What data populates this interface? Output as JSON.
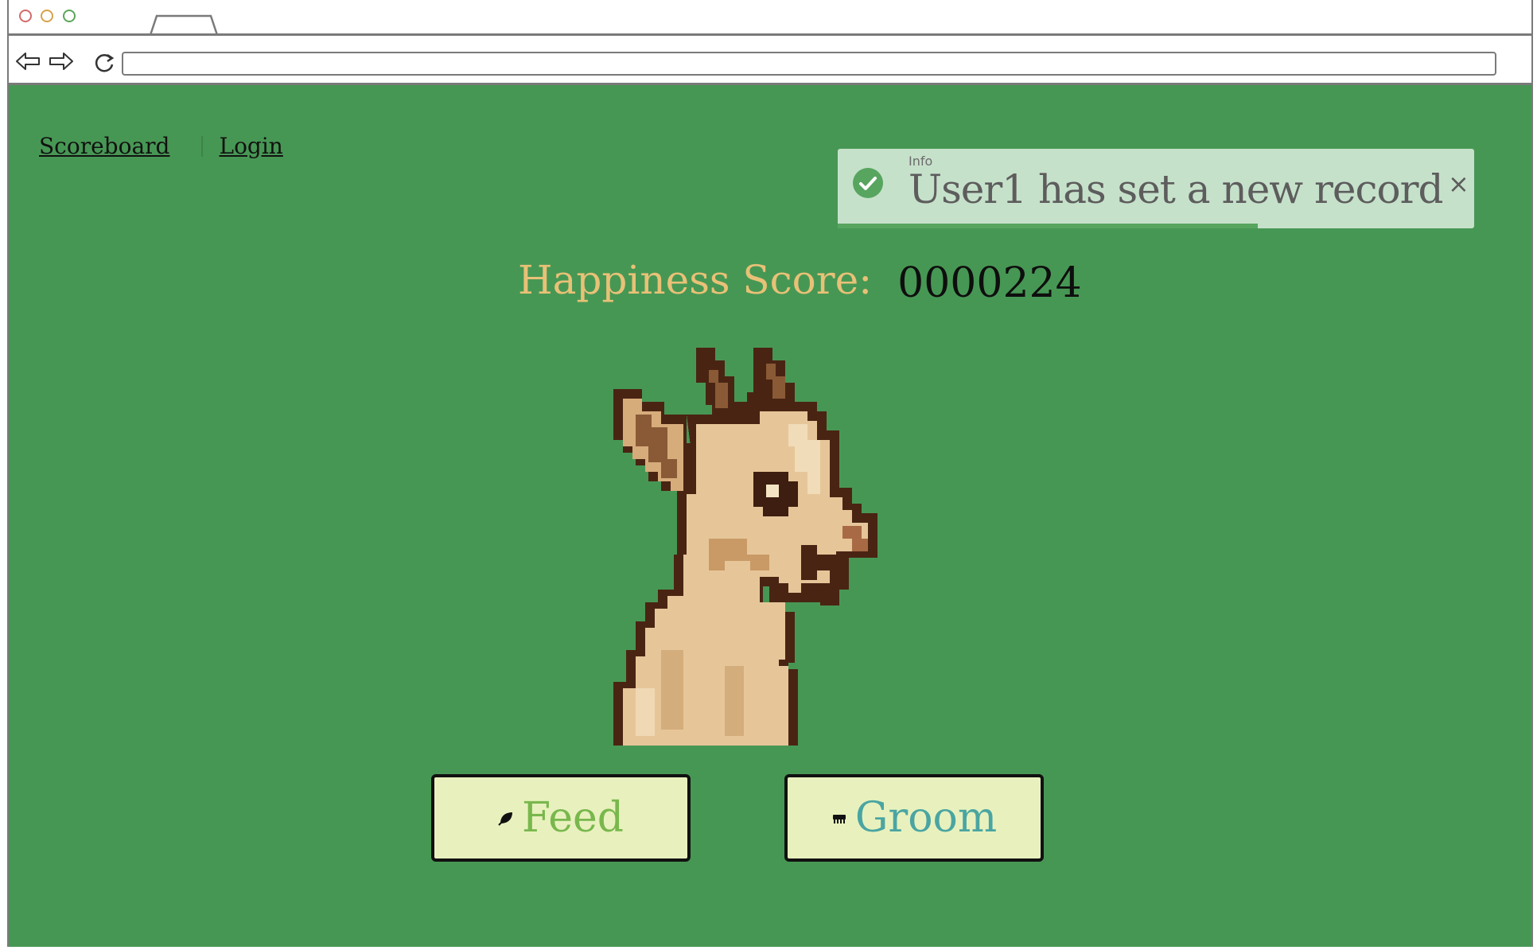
{
  "browser": {
    "controls": [
      "close-dot",
      "minimize-dot",
      "maximize-dot"
    ],
    "url": ""
  },
  "nav": {
    "scoreboard_label": "Scoreboard",
    "login_label": "Login"
  },
  "toast": {
    "title": "Info",
    "message": "User1 has set a new record",
    "close_symbol": "×",
    "progress_fraction": 0.66,
    "icon": "check-circle-icon",
    "color": "#c6e1ca"
  },
  "score": {
    "label": "Happiness Score:",
    "value": "0000224"
  },
  "goat": {
    "icon": "goat-pixel-art"
  },
  "actions": {
    "feed_label": "Feed",
    "groom_label": "Groom",
    "feed_icon": "leaf-icon",
    "groom_icon": "brush-icon"
  },
  "colors": {
    "background": "#479754",
    "score_label": "#e8c177",
    "button_bg": "#e8f1bd",
    "feed_text": "#79b74d",
    "groom_text": "#4aa5a2"
  }
}
